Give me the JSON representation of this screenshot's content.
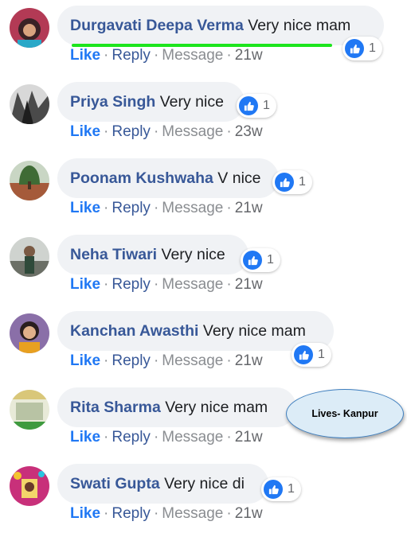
{
  "comments": [
    {
      "author": "Durgavati Deepa Verma",
      "text": "Very nice mam",
      "reactions": "1",
      "like": "Like",
      "reply": "Reply",
      "message": "Message",
      "time": "21w"
    },
    {
      "author": "Priya Singh",
      "text": "Very nice",
      "reactions": "1",
      "like": "Like",
      "reply": "Reply",
      "message": "Message",
      "time": "23w"
    },
    {
      "author": "Poonam Kushwaha",
      "text": "V nice",
      "reactions": "1",
      "like": "Like",
      "reply": "Reply",
      "message": "Message",
      "time": "21w"
    },
    {
      "author": "Neha Tiwari",
      "text": "Very nice",
      "reactions": "1",
      "like": "Like",
      "reply": "Reply",
      "message": "Message",
      "time": "21w"
    },
    {
      "author": "Kanchan Awasthi",
      "text": "Very nice mam",
      "reactions": "1",
      "like": "Like",
      "reply": "Reply",
      "message": "Message",
      "time": "21w"
    },
    {
      "author": "Rita Sharma",
      "text": "Very nice mam",
      "like": "Like",
      "reply": "Reply",
      "message": "Message",
      "time": "21w"
    },
    {
      "author": "Swati Gupta",
      "text": "Very nice di",
      "reactions": "1",
      "like": "Like",
      "reply": "Reply",
      "message": "Message",
      "time": "21w"
    }
  ],
  "callout": {
    "text": "Lives- Kanpur"
  },
  "colors": {
    "author": "#385898",
    "like_action": "#2078f4",
    "bubble": "#f0f2f5",
    "highlight": "#1de51d",
    "callout_fill": "#dcecf7",
    "callout_border": "#3f7fbf"
  },
  "icons": {
    "reaction": "thumbs-up-icon"
  }
}
